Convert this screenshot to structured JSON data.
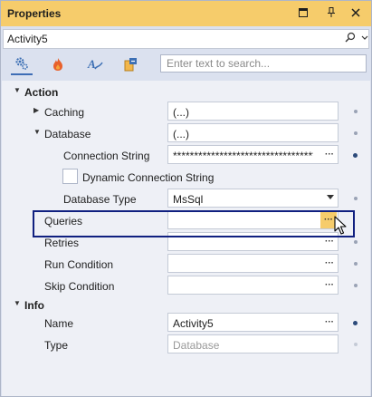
{
  "window": {
    "title": "Properties",
    "buttons": [
      "window-position-icon",
      "pin-icon",
      "close-icon"
    ]
  },
  "object_selector": {
    "value": "Activity5",
    "search_icon": "search-icon",
    "dropdown_icon": "chevron-down-icon"
  },
  "toolbar": {
    "tabs": [
      {
        "icon": "properties-gear-icon",
        "active": true
      },
      {
        "icon": "events-flame-icon",
        "active": false
      },
      {
        "icon": "styles-text-icon",
        "active": false
      },
      {
        "icon": "variables-icon",
        "active": false
      }
    ],
    "search": {
      "placeholder": "Enter text to search..."
    }
  },
  "grid": {
    "action": {
      "label": "Action",
      "caching": {
        "label": "Caching",
        "value": "(...)"
      },
      "database": {
        "label": "Database",
        "value": "(...)",
        "connection_string": {
          "label": "Connection String",
          "value": "**********************************"
        },
        "dynamic_connection_string": {
          "label": "Dynamic Connection String",
          "checked": false
        },
        "database_type": {
          "label": "Database Type",
          "value": "MsSql"
        }
      },
      "queries": {
        "label": "Queries",
        "value": ""
      },
      "retries": {
        "label": "Retries",
        "value": ""
      },
      "run_condition": {
        "label": "Run Condition",
        "value": ""
      },
      "skip_condition": {
        "label": "Skip Condition",
        "value": ""
      }
    },
    "info": {
      "label": "Info",
      "name": {
        "label": "Name",
        "value": "Activity5"
      },
      "type": {
        "label": "Type",
        "value": "Database"
      }
    },
    "ellipsis": "···"
  },
  "colors": {
    "title_bar": "#f6cc6b",
    "grid_background": "#eef0f6",
    "highlight_border": "#102080",
    "active_button": "#f6cc6b"
  }
}
